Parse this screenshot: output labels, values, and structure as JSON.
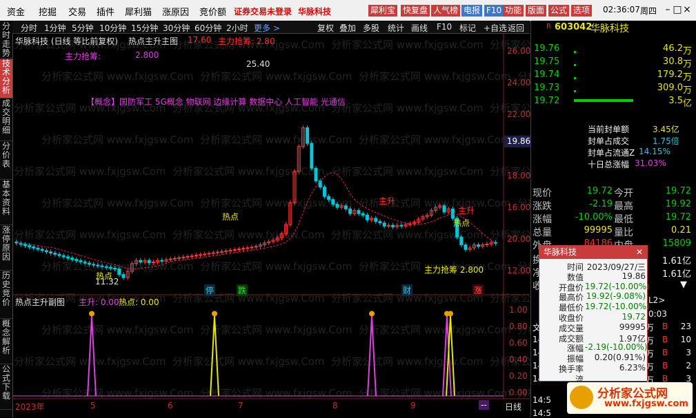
{
  "menu": {
    "items": [
      "资金",
      "挖掘",
      "交易",
      "插件",
      "犀利猫",
      "涨原因",
      "竞价额"
    ],
    "warning": "证券交易未登录",
    "stock_name": "华脉科技",
    "tools": [
      "犀利宝",
      "快复盘",
      "人气榜",
      "电报",
      "F10",
      "功能",
      "版面",
      "公式",
      "选项"
    ],
    "time": "02:36:07",
    "weekday": "周四",
    "win_buttons": [
      "–",
      "□",
      "×"
    ]
  },
  "left_tabs": [
    "分时走势",
    "技术分析",
    "成交明细",
    "分价表",
    "基本资料",
    "涨停原因",
    "历史竞价",
    "概念解析",
    "公式下载"
  ],
  "period_bar": {
    "periods": [
      "分时",
      "1分钟",
      "5分钟",
      "10分钟",
      "15分钟",
      "30分钟",
      "60分钟",
      "2小时"
    ],
    "more": "更多 >",
    "actions": [
      "复权",
      "叠加",
      "多股",
      "统计",
      "画线",
      "F10",
      "标记",
      "+自选",
      "返回"
    ]
  },
  "main_chart": {
    "title": "华脉科技 (日线 等比前复权)",
    "indicator_name": "热点主升主图",
    "indicator_v1": "17.60",
    "indicator_label2": "主力抢筹: 2.80",
    "zlqc_label": "主力抢筹:",
    "zlqc_value": "2.800",
    "concept": "【概念】国防军工 5G概念 物联网 边缘计算 数据中心 人工智能 光通信",
    "high_label": "25.40",
    "low_label": "11.32",
    "hot_labels": [
      "热点",
      "热点",
      "热点"
    ],
    "main_rise": "主升",
    "main_rise2": "主升",
    "bottom_zlqc": "主力抢筹 2.800",
    "current_price_box": "19.86",
    "limit_status": "跌停",
    "event_tags": [
      "停",
      "跌",
      "财",
      "涨"
    ],
    "axis_ticks": [
      "26.00",
      "24.00",
      "22.00",
      "20.00",
      "18.00",
      "16.00",
      "14.00",
      "12.00"
    ]
  },
  "sub_chart": {
    "name": "热点主升副图",
    "v1_label": "主升: 0.00",
    "v2_label": "热点: 0.00",
    "axis_ticks": [
      "1.00",
      "0.80",
      "0.60",
      "0.40",
      "0.20",
      "0.00"
    ],
    "time_labels": [
      "2023年",
      "5",
      "6",
      "7",
      "8",
      "9"
    ],
    "period_label": "日线",
    "end_marker": "--"
  },
  "chart_data": {
    "type": "candlestick",
    "title": "华脉科技 (日线 等比前复权)",
    "ylim": [
      11,
      26.5
    ],
    "annotated_high": 25.4,
    "annotated_low": 11.32
  },
  "quote": {
    "code": "603042",
    "name": "华脉科技",
    "r_label": "R",
    "bids": [
      {
        "price": "19.76",
        "vol": "46.2",
        "unit": "万"
      },
      {
        "price": "19.75",
        "vol": "30.8",
        "unit": "万"
      },
      {
        "price": "19.74",
        "vol": "179.2",
        "unit": "万"
      },
      {
        "price": "19.73",
        "vol": "309.0",
        "unit": "万"
      },
      {
        "price": "19.72",
        "vol": "3.5",
        "unit": "亿"
      }
    ],
    "limit_info": [
      {
        "label": "当前封单额",
        "value": "3.45亿"
      },
      {
        "label": "封单占成交",
        "value": "1.75倍"
      },
      {
        "label": "封单占流通Z",
        "value": "14.15%"
      },
      {
        "label": "十日总涨幅",
        "value": "31.03%"
      }
    ],
    "stats": [
      {
        "l1": "现价",
        "v1": "19.72",
        "l2": "今开",
        "v2": "19.72"
      },
      {
        "l1": "涨跌",
        "v1": "-2.19",
        "l2": "最高",
        "v2": "19.92"
      },
      {
        "l1": "涨幅",
        "v1": "-10.00%",
        "l2": "最低",
        "v2": "19.72"
      },
      {
        "l1": "总量",
        "v1": "99995",
        "l2": "量比",
        "v2": "0.21"
      },
      {
        "l1": "外盘",
        "v1": "84186",
        "l2": "内盘",
        "v2": "15809"
      }
    ],
    "extra_rows": [
      {
        "l": "换",
        "v": "1.61亿"
      },
      {
        "l": "净",
        "v": "1.61亿"
      },
      {
        "l": "收",
        "v": "▼"
      }
    ],
    "l2_text": "L2>",
    "time_frag": "0:03",
    "trade_rows": [
      {
        "t": "文",
        "v": "万",
        "f": "B",
        "n": "23"
      },
      {
        "t": "14",
        "v": "万",
        "f": "B",
        "n": "10"
      },
      {
        "t": "14",
        "v": "万",
        "f": "B",
        "n": "3"
      },
      {
        "t": "14",
        "v": "万",
        "f": "B",
        "n": "2"
      },
      {
        "t": "14",
        "v": "万",
        "f": "B",
        "n": "3"
      },
      {
        "t": "14:5",
        "v": "",
        "f": "B",
        "n": "3"
      },
      {
        "t": "14:5",
        "v": "",
        "f": "B",
        "n": "2"
      }
    ]
  },
  "popup": {
    "title": "华脉科技",
    "rows": [
      {
        "label": "时间",
        "value": "2023/09/27/三",
        "color": "#222222"
      },
      {
        "label": "数值",
        "value": "19.86",
        "color": "#222222"
      },
      {
        "label": "开盘价",
        "value": "19.72(-10.00%)",
        "color": "#008000"
      },
      {
        "label": "最高价",
        "value": "19.92(-9.08%)",
        "color": "#008000"
      },
      {
        "label": "最低价",
        "value": "19.72(-10.00%)",
        "color": "#008000"
      },
      {
        "label": "收盘价",
        "value": "19.72",
        "color": "#008000"
      },
      {
        "label": "成交量",
        "value": "99995",
        "color": "#222222"
      },
      {
        "label": "成交额",
        "value": "1.97亿",
        "color": "#222222"
      },
      {
        "label": "涨幅",
        "value": "-2.19(-10.00%)",
        "color": "#008000"
      },
      {
        "label": "振幅",
        "value": "0.20(0.91%)",
        "color": "#222222"
      },
      {
        "label": "换手率",
        "value": "6.23%",
        "color": "#222222"
      },
      {
        "label": "流",
        "value": "",
        "color": "#222222"
      }
    ]
  },
  "watermark": {
    "brand": "分析家公式网",
    "url": "www.fxjgsw.com",
    "bg_text": "分析家公式网 www.fxjgsw.Com"
  },
  "colors": {
    "up": "#ff3c3c",
    "down": "#00c8d8",
    "ma": "#e0206a",
    "accent_red": "#c83c3c"
  }
}
